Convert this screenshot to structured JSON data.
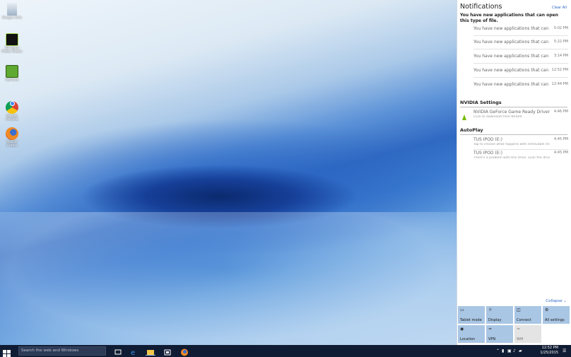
{
  "desktop": {
    "icons": [
      {
        "label": "Google Chro"
      },
      {
        "label": "3D Vision Photo Viewer"
      },
      {
        "label": "GeForce"
      },
      {
        "label": "Google Chrome"
      },
      {
        "label": "Mozilla Firefox"
      }
    ]
  },
  "action_center": {
    "title": "Notifications",
    "clear_all": "Clear All",
    "header_message": "You have new applications that can open this type of file.",
    "app_notifications": [
      {
        "text": "You have new applications that can ope",
        "time": "5:02 PM"
      },
      {
        "text": "You have new applications that can ope",
        "time": "5:22 PM"
      },
      {
        "text": "You have new applications that can ope",
        "time": "3:14 PM"
      },
      {
        "text": "You have new applications that can op",
        "time": "12:52 PM"
      },
      {
        "text": "You have new applications that can op",
        "time": "12:44 PM"
      }
    ],
    "nvidia": {
      "group": "NVIDIA Settings",
      "title": "NVIDIA GeForce Game Ready Driver is a",
      "subtitle": "Click to download from NVIDIA",
      "time": "4:46 PM"
    },
    "autoplay": {
      "group": "AutoPlay",
      "items": [
        {
          "title": "TUS IPOD (E:)",
          "subtitle": "Tap to choose what happens with removable driv",
          "time": "4:45 PM"
        },
        {
          "title": "TUS IPOD (E:)",
          "subtitle": "There's a problem with this drive. Scan the drive r",
          "time": "4:45 PM"
        }
      ]
    },
    "collapse": "Collapse",
    "quick_actions": [
      {
        "label": "Tablet mode",
        "icon": "tablet-icon",
        "on": true
      },
      {
        "label": "Display",
        "icon": "sun-icon",
        "on": true
      },
      {
        "label": "Connect",
        "icon": "monitor-icon",
        "on": true
      },
      {
        "label": "All settings",
        "icon": "gear-icon",
        "on": true
      },
      {
        "label": "Location",
        "icon": "location-icon",
        "on": true
      },
      {
        "label": "VPN",
        "icon": "vpn-icon",
        "on": true
      },
      {
        "label": "Wifi",
        "icon": "wifi-icon",
        "on": false
      }
    ]
  },
  "taskbar": {
    "search_placeholder": "Search the web and Windows",
    "clock_time": "12:52 PM",
    "clock_date": "1/25/2015"
  },
  "colors": {
    "accent": "#2a66c4",
    "tile_on": "#a9c6e4",
    "taskbar": "#101c33"
  }
}
